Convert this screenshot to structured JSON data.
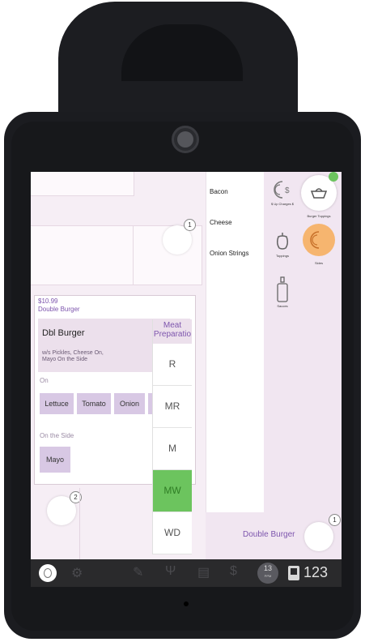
{
  "ticket": {
    "price": "$10.99",
    "item_name": "Double Burger",
    "short_name": "Dbl Burger",
    "notes_line1": "w/s Pickles, Cheese On,",
    "notes_line2": "Mayo On the Side"
  },
  "modifier_groups": {
    "on_label": "On",
    "on_items": [
      "Lettuce",
      "Tomato",
      "Onion"
    ],
    "side_label": "On the Side",
    "side_items": [
      "Mayo"
    ]
  },
  "meat_preparation": {
    "header_line1": "Meat",
    "header_line2": "Preparatio",
    "options": [
      "R",
      "MR",
      "M",
      "MW",
      "WD"
    ],
    "selected": "MW"
  },
  "mods_list": [
    "Bacon",
    "Cheese",
    "Onion Strings"
  ],
  "categories": [
    {
      "label": "$ Up Charges $",
      "icon": "dollar-icon"
    },
    {
      "label": "Burger Toppings",
      "icon": "bowl-icon"
    },
    {
      "label": "Toppings",
      "icon": "pepper-icon"
    },
    {
      "label": "Sides",
      "icon": "fries-icon"
    },
    {
      "label": "Sauces",
      "icon": "bottle-icon"
    }
  ],
  "seats": {
    "seat1": "1",
    "seat2": "2"
  },
  "order_line": {
    "item": "Double Burger",
    "seat": "1"
  },
  "bottom_bar": {
    "page_count": "13",
    "page_label": "PPM",
    "number": "123"
  },
  "colors": {
    "accent_purple": "#7d55ad",
    "selected_green": "#6cc45e",
    "sides_orange": "#f6b56f"
  }
}
